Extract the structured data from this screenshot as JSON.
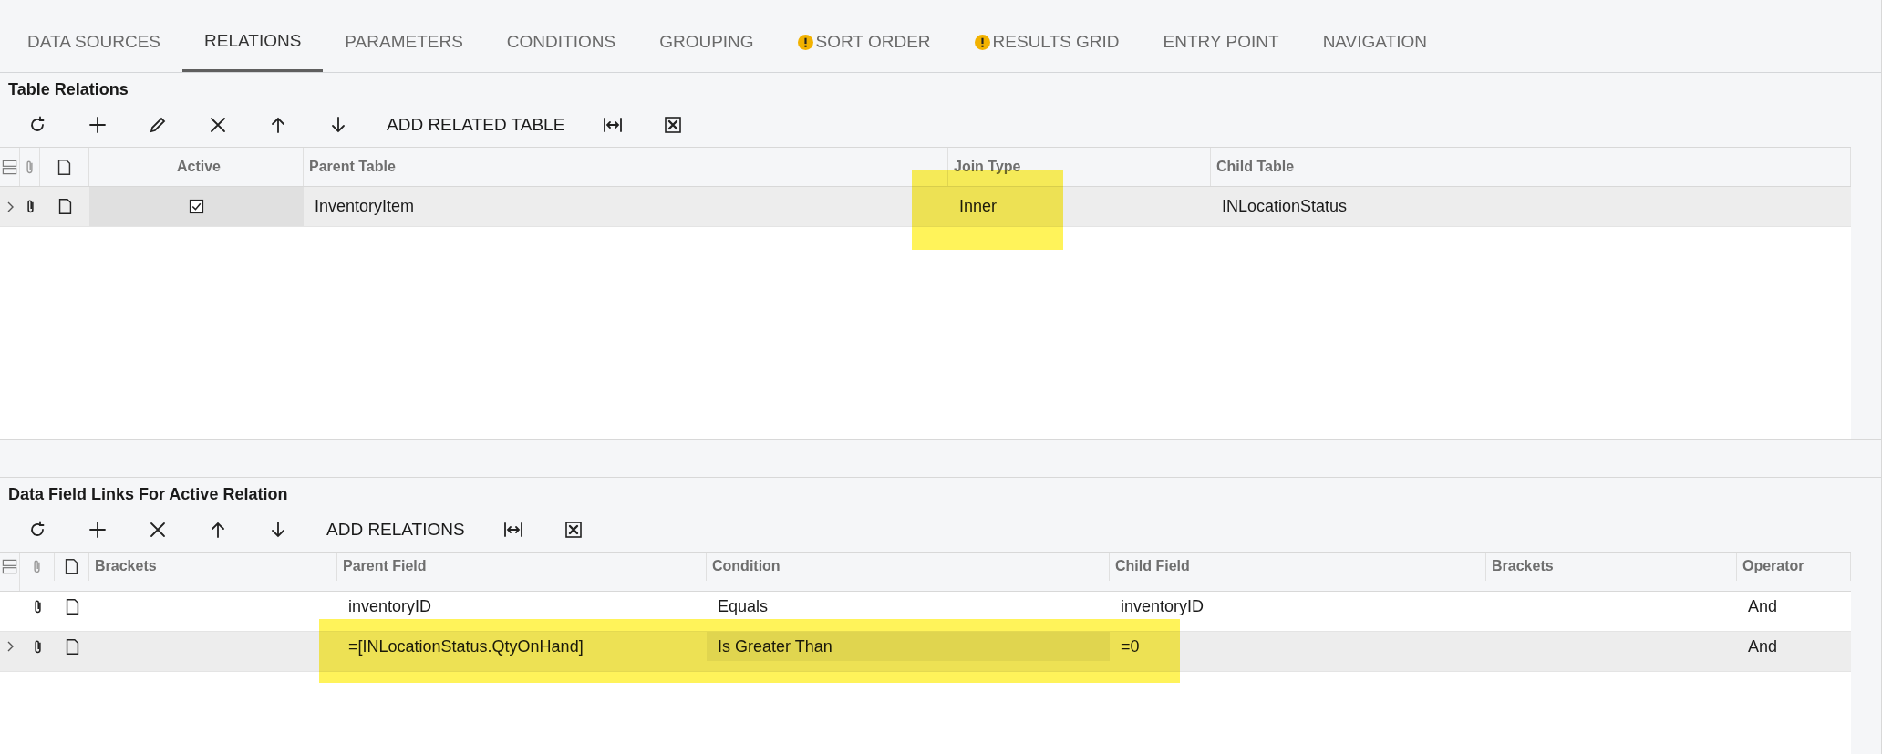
{
  "tabs": [
    {
      "label": "DATA SOURCES",
      "selected": false,
      "warning": false
    },
    {
      "label": "RELATIONS",
      "selected": true,
      "warning": false
    },
    {
      "label": "PARAMETERS",
      "selected": false,
      "warning": false
    },
    {
      "label": "CONDITIONS",
      "selected": false,
      "warning": false
    },
    {
      "label": "GROUPING",
      "selected": false,
      "warning": false
    },
    {
      "label": "SORT ORDER",
      "selected": false,
      "warning": true
    },
    {
      "label": "RESULTS GRID",
      "selected": false,
      "warning": true
    },
    {
      "label": "ENTRY POINT",
      "selected": false,
      "warning": false
    },
    {
      "label": "NAVIGATION",
      "selected": false,
      "warning": false
    }
  ],
  "table_relations": {
    "title": "Table Relations",
    "toolbar": [
      {
        "kind": "refresh"
      },
      {
        "kind": "add"
      },
      {
        "kind": "edit"
      },
      {
        "kind": "delete"
      },
      {
        "kind": "up"
      },
      {
        "kind": "down"
      },
      {
        "kind": "text",
        "label": "ADD RELATED TABLE"
      },
      {
        "kind": "fit"
      },
      {
        "kind": "excel"
      }
    ],
    "columns": [
      "Active",
      "Parent Table",
      "Join Type",
      "Child Table"
    ],
    "rows": [
      {
        "selected": true,
        "active": true,
        "parent_table": "InventoryItem",
        "join_type": "Inner",
        "child_table": "INLocationStatus"
      }
    ]
  },
  "data_field_links": {
    "title": "Data Field Links For Active Relation",
    "toolbar": [
      {
        "kind": "refresh"
      },
      {
        "kind": "add"
      },
      {
        "kind": "delete"
      },
      {
        "kind": "up"
      },
      {
        "kind": "down"
      },
      {
        "kind": "text",
        "label": "ADD RELATIONS"
      },
      {
        "kind": "fit"
      },
      {
        "kind": "excel"
      }
    ],
    "columns": [
      "Brackets",
      "Parent Field",
      "Condition",
      "Child Field",
      "Brackets",
      "Operator"
    ],
    "rows": [
      {
        "selected": false,
        "cells": [
          "",
          "inventoryID",
          "Equals",
          "inventoryID",
          "",
          "And"
        ]
      },
      {
        "selected": true,
        "cells": [
          "",
          "=[INLocationStatus.QtyOnHand]",
          "Is Greater Than",
          "=0",
          "",
          "And"
        ]
      }
    ]
  }
}
